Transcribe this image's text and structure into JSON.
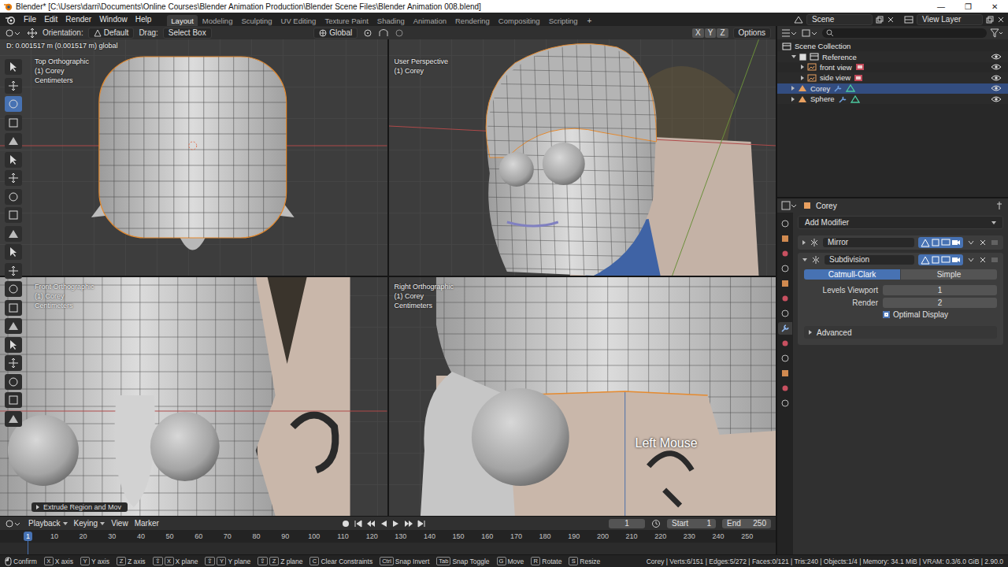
{
  "window": {
    "title": "Blender* [C:\\Users\\darri\\Documents\\Online Courses\\Blender Animation Production\\Blender Scene Files\\Blender Animation 008.blend]",
    "controls": [
      "—",
      "❐",
      "✕"
    ]
  },
  "menu": [
    "File",
    "Edit",
    "Render",
    "Window",
    "Help"
  ],
  "workspaces": [
    {
      "label": "Layout",
      "selected": true
    },
    {
      "label": "Modeling",
      "selected": false
    },
    {
      "label": "Sculpting",
      "selected": false
    },
    {
      "label": "UV Editing",
      "selected": false
    },
    {
      "label": "Texture Paint",
      "selected": false
    },
    {
      "label": "Shading",
      "selected": false
    },
    {
      "label": "Animation",
      "selected": false
    },
    {
      "label": "Rendering",
      "selected": false
    },
    {
      "label": "Compositing",
      "selected": false
    },
    {
      "label": "Scripting",
      "selected": false
    }
  ],
  "add_workspace": "+",
  "scene": "Scene",
  "view_layer": "View Layer",
  "viewport_header": {
    "orientation_label": "Orientation:",
    "orientation": "Default",
    "drag_label": "Drag:",
    "drag": "Select Box",
    "transform": "Global",
    "axes": [
      "X",
      "Y",
      "Z"
    ],
    "options": "Options"
  },
  "viewport_info": "D: 0.001517 m (0.001517 m) global",
  "tools": [
    {
      "selected": false
    },
    {
      "selected": false
    },
    {
      "selected": true
    },
    {
      "selected": false
    },
    {
      "selected": false
    },
    {
      "selected": false
    },
    {
      "selected": false
    },
    {
      "selected": false
    },
    {
      "selected": false
    },
    {
      "selected": false
    },
    {
      "selected": false
    },
    {
      "selected": false
    },
    {
      "selected": false
    },
    {
      "selected": false
    },
    {
      "selected": false
    },
    {
      "selected": false
    },
    {
      "selected": false
    },
    {
      "selected": false
    },
    {
      "selected": false
    },
    {
      "selected": false
    }
  ],
  "viewports": [
    {
      "kind": "top",
      "view": "Top Orthographic",
      "object": "(1) Corey",
      "units": "Centimeters"
    },
    {
      "kind": "perspective",
      "view": "User Perspective",
      "object": "(1) Corey"
    },
    {
      "kind": "front",
      "view": "Front Orthographic",
      "object": "(1) Corey",
      "units": "Centimeters"
    },
    {
      "kind": "right",
      "view": "Right Orthographic",
      "object": "(1) Corey",
      "units": "Centimeters"
    }
  ],
  "overlay_key": "Left Mouse",
  "operator_panel": "Extrude Region and Mov",
  "outliner": {
    "items": [
      {
        "label": "Scene Collection",
        "depth": 0,
        "kind": "scene",
        "selected": false,
        "expanded": true,
        "checked": false
      },
      {
        "label": "Reference",
        "depth": 1,
        "kind": "collection",
        "selected": false,
        "expanded": true,
        "checked": true
      },
      {
        "label": "front view",
        "depth": 2,
        "kind": "image",
        "selected": false,
        "expanded": false,
        "checked": false
      },
      {
        "label": "side view",
        "depth": 2,
        "kind": "image",
        "selected": false,
        "expanded": false,
        "checked": false
      },
      {
        "label": "Corey",
        "depth": 1,
        "kind": "mesh",
        "selected": true,
        "expanded": false,
        "checked": false
      },
      {
        "label": "Sphere",
        "depth": 1,
        "kind": "mesh",
        "selected": false,
        "expanded": false,
        "checked": false
      }
    ]
  },
  "properties": {
    "object": "Corey",
    "add_modifier": "Add Modifier",
    "tabs": [
      {
        "selected": false
      },
      {
        "selected": false
      },
      {
        "selected": false
      },
      {
        "selected": false
      },
      {
        "selected": false
      },
      {
        "selected": false
      },
      {
        "selected": false
      },
      {
        "selected": true
      },
      {
        "selected": false
      },
      {
        "selected": false
      },
      {
        "selected": false
      },
      {
        "selected": false
      },
      {
        "selected": false
      }
    ],
    "modifiers": [
      {
        "name": "Mirror",
        "expanded": false
      },
      {
        "name": "Subdivision",
        "expanded": true,
        "settings": {
          "methods": [
            {
              "label": "Catmull-Clark",
              "selected": true
            },
            {
              "label": "Simple",
              "selected": false
            }
          ],
          "fields": [
            {
              "label": "Levels Viewport",
              "value": "1"
            },
            {
              "label": "Render",
              "value": "2"
            }
          ],
          "optimal_display": {
            "label": "Optimal Display",
            "checked": true
          },
          "advanced": {
            "label": "Advanced",
            "expanded": false
          }
        }
      }
    ]
  },
  "timeline": {
    "menus": [
      {
        "label": "Playback",
        "dropdown": true
      },
      {
        "label": "Keying",
        "dropdown": true
      },
      {
        "label": "View",
        "dropdown": false
      },
      {
        "label": "Marker",
        "dropdown": false
      }
    ],
    "current": "1",
    "start_label": "Start",
    "start": "1",
    "end_label": "End",
    "end": "250",
    "ticks": [
      "10",
      "20",
      "30",
      "40",
      "50",
      "60",
      "70",
      "80",
      "90",
      "100",
      "110",
      "120",
      "130",
      "140",
      "150",
      "160",
      "170",
      "180",
      "190",
      "200",
      "210",
      "220",
      "230",
      "240",
      "250"
    ]
  },
  "status_bar": {
    "items": [
      {
        "kind": "mouse",
        "keys": [],
        "label": "Confirm"
      },
      {
        "kind": "key",
        "keys": [
          "X"
        ],
        "label": "X axis"
      },
      {
        "kind": "key",
        "keys": [
          "Y"
        ],
        "label": "Y axis"
      },
      {
        "kind": "key",
        "keys": [
          "Z"
        ],
        "label": "Z axis"
      },
      {
        "kind": "key",
        "keys": [
          "⇧",
          "X"
        ],
        "label": "X plane"
      },
      {
        "kind": "key",
        "keys": [
          "⇧",
          "Y"
        ],
        "label": "Y plane"
      },
      {
        "kind": "key",
        "keys": [
          "⇧",
          "Z"
        ],
        "label": "Z plane"
      },
      {
        "kind": "key",
        "keys": [
          "C"
        ],
        "label": "Clear Constraints"
      },
      {
        "kind": "key",
        "keys": [
          "Ctrl"
        ],
        "label": "Snap Invert"
      },
      {
        "kind": "key",
        "keys": [
          "Tab"
        ],
        "label": "Snap Toggle"
      },
      {
        "kind": "key",
        "keys": [
          "G"
        ],
        "label": "Move"
      },
      {
        "kind": "key",
        "keys": [
          "R"
        ],
        "label": "Rotate"
      },
      {
        "kind": "key",
        "keys": [
          "S"
        ],
        "label": "Resize"
      }
    ],
    "stats": "Corey | Verts:6/151 | Edges:5/272 | Faces:0/121 | Tris:240 | Objects:1/4 | Memory: 34.1 MiB | VRAM: 0.3/6.0 GiB | 2.90.0"
  }
}
